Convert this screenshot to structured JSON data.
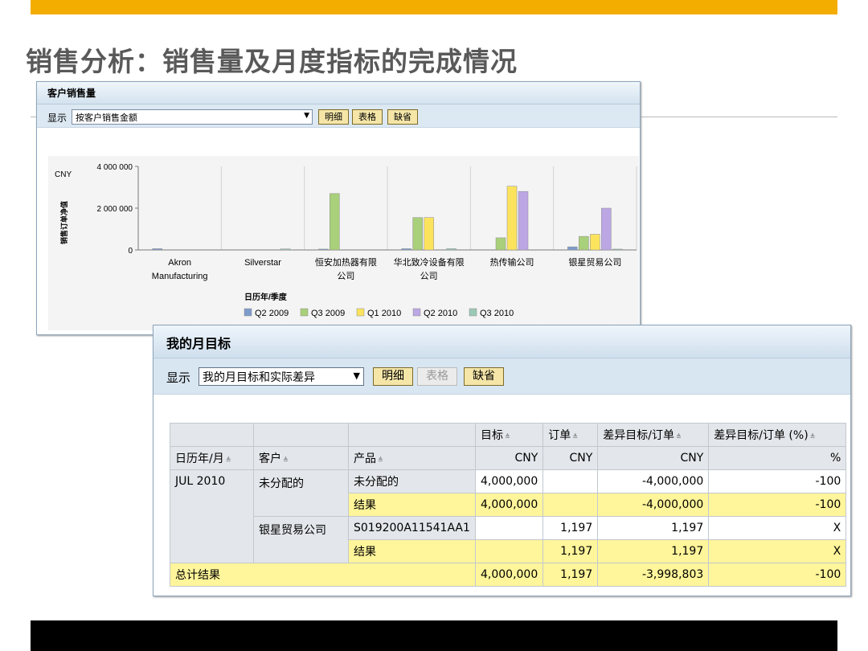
{
  "slide": {
    "title": "销售分析：销售量及月度指标的完成情况"
  },
  "window1": {
    "title": "客户销售量",
    "show_label": "显示",
    "select_value": "按客户销售金额",
    "buttons": {
      "detail": "明细",
      "table": "表格",
      "default": "缺省"
    },
    "chart_data": {
      "type": "bar",
      "unit": "CNY",
      "ylabel": "销售订单净值",
      "yticks": [
        "4 000 000",
        "2 000 000",
        "0"
      ],
      "ylim": [
        0,
        4000000
      ],
      "legend_title": "日历年/季度",
      "categories": [
        [
          "Akron",
          "Manufacturing"
        ],
        [
          "Silverstar"
        ],
        [
          "恒安加热器有限",
          "公司"
        ],
        [
          "华北致冷设备有限",
          "公司"
        ],
        [
          "热传输公司"
        ],
        [
          "银星贸易公司"
        ]
      ],
      "series": [
        {
          "name": "Q2 2009",
          "color": "#7d9ccc",
          "values": [
            60000,
            0,
            40000,
            60000,
            0,
            150000
          ]
        },
        {
          "name": "Q3 2009",
          "color": "#a9d07a",
          "values": [
            0,
            0,
            2700000,
            1550000,
            580000,
            650000
          ]
        },
        {
          "name": "Q1 2010",
          "color": "#fce35e",
          "values": [
            0,
            0,
            0,
            1550000,
            3050000,
            750000
          ]
        },
        {
          "name": "Q2 2010",
          "color": "#bca7e4",
          "values": [
            0,
            0,
            0,
            0,
            2800000,
            2000000
          ]
        },
        {
          "name": "Q3 2010",
          "color": "#9cc9b6",
          "values": [
            0,
            50000,
            0,
            60000,
            0,
            40000
          ]
        }
      ]
    }
  },
  "window2": {
    "title": "我的月目标",
    "show_label": "显示",
    "select_value": "我的月目标和实际差异",
    "buttons": {
      "detail": "明细",
      "table": "表格",
      "default": "缺省"
    },
    "table": {
      "col_headers": [
        "目标",
        "订单",
        "差异目标/订单",
        "差异目标/订单 (%)"
      ],
      "dim_headers": [
        "日历年/月",
        "客户",
        "产品"
      ],
      "units": [
        "CNY",
        "CNY",
        "CNY",
        "%"
      ],
      "month": "JUL 2010",
      "customer1": "未分配的",
      "customer2": "银星贸易公司",
      "rows": [
        {
          "product": "未分配的",
          "values": [
            "4,000,000",
            "",
            "-4,000,000",
            "-100"
          ]
        },
        {
          "product": "结果",
          "values": [
            "4,000,000",
            "",
            "-4,000,000",
            "-100"
          ]
        },
        {
          "product": "S019200A11541AA1",
          "values": [
            "",
            "1,197",
            "1,197",
            "X"
          ]
        },
        {
          "product": "结果",
          "values": [
            "",
            "1,197",
            "1,197",
            "X"
          ]
        }
      ],
      "total": {
        "label": "总计结果",
        "values": [
          "4,000,000",
          "1,197",
          "-3,998,803",
          "-100"
        ]
      }
    }
  }
}
